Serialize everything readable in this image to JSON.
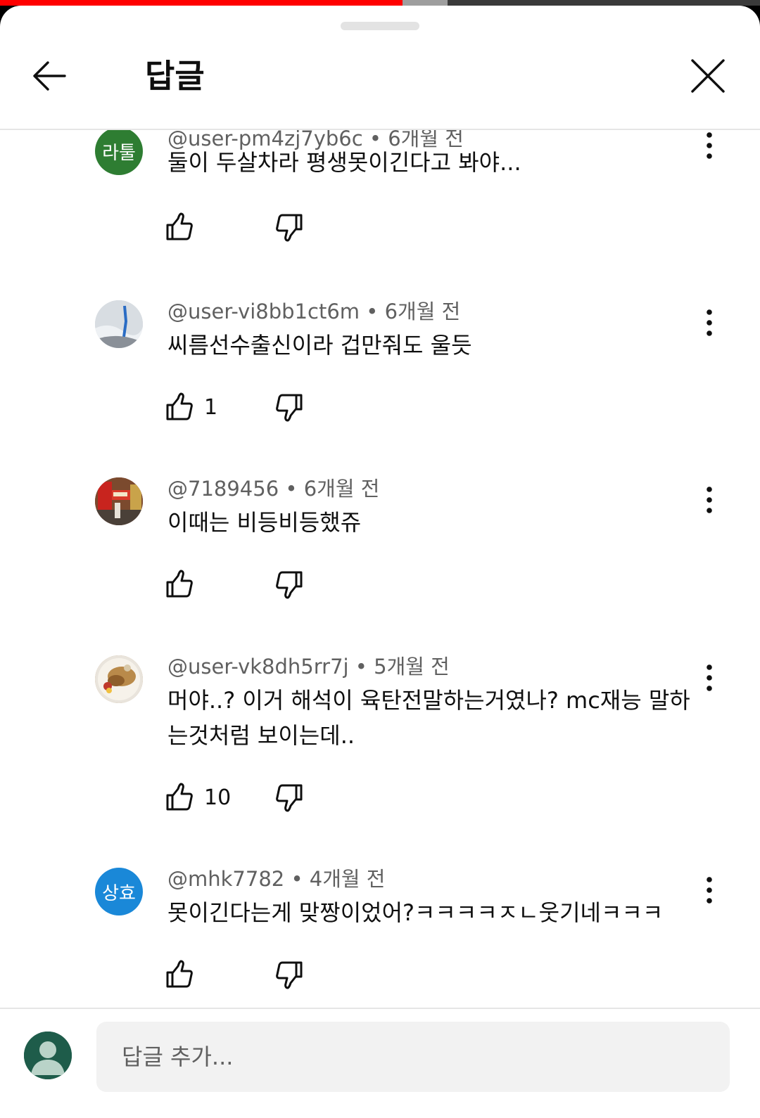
{
  "player": {
    "progress_fraction": 0.53
  },
  "header": {
    "title": "답글",
    "back_icon": "arrow-left-icon",
    "close_icon": "close-icon"
  },
  "comments": [
    {
      "author": "@user-pm4zj7yb6c",
      "time": "6개월 전",
      "avatar_text": "라툴",
      "avatar_color": "#2e7d32",
      "text": "둘이 두살차라 평생못이긴다고 봐야...",
      "likes": ""
    },
    {
      "author": "@user-vi8bb1ct6m",
      "time": "6개월 전",
      "avatar_text": "",
      "avatar_color": "#c9ced3",
      "text": "씨름선수출신이라 겁만줘도 울듯",
      "likes": "1"
    },
    {
      "author": "@7189456",
      "time": "6개월 전",
      "avatar_text": "",
      "avatar_color": "#8a3a2a",
      "text": "이때는 비등비등했쥬",
      "likes": ""
    },
    {
      "author": "@user-vk8dh5rr7j",
      "time": "5개월 전",
      "avatar_text": "",
      "avatar_color": "#b89566",
      "text": "머야..? 이거 해석이 육탄전말하는거였나? mc재능 말하는것처럼 보이는데..",
      "likes": "10"
    },
    {
      "author": "@mhk7782",
      "time": "4개월 전",
      "avatar_text": "상효",
      "avatar_color": "#1a88d8",
      "text": "못이긴다는게 맞짱이었어?ㅋㅋㅋㅋㅈㄴ웃기네ㅋㅋㅋ",
      "likes": ""
    }
  ],
  "footer": {
    "placeholder": "답글 추가..."
  },
  "colors": {
    "accent": "#ff0000",
    "text_primary": "#0f0f0f",
    "text_secondary": "#606060"
  }
}
